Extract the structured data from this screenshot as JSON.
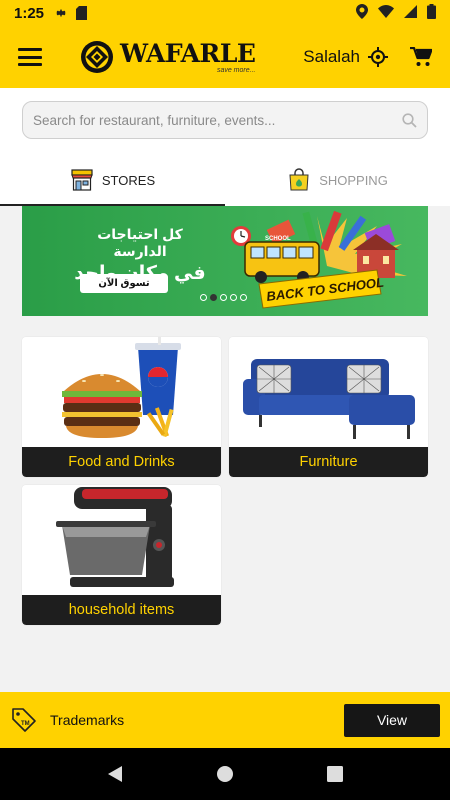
{
  "status_bar": {
    "time": "1:25"
  },
  "app_bar": {
    "logo_word": "WAFARLE",
    "logo_tagline": "save more...",
    "location": "Salalah"
  },
  "search": {
    "placeholder": "Search for restaurant, furniture, events..."
  },
  "tabs": [
    {
      "label": "STORES",
      "active": true
    },
    {
      "label": "SHOPPING",
      "active": false
    }
  ],
  "banner": {
    "line1": "كل احتياجات الدارسة",
    "line2": "في مكان واحد",
    "button_label": "تسوق الآن",
    "art_text": "BACK TO SCHOOL",
    "bus_text": "SCHOOL",
    "slides": 5,
    "active_slide": 2
  },
  "categories": [
    {
      "label": "Food and Drinks",
      "image": "burger-and-soda"
    },
    {
      "label": "Furniture",
      "image": "blue-sofa"
    },
    {
      "label": "household items",
      "image": "stand-mixer"
    }
  ],
  "trademarks": {
    "label": "Trademarks",
    "button_label": "View"
  },
  "colors": {
    "brand_yellow": "#ffd200",
    "banner_green": "#3cae56",
    "dark": "#1e1e1e"
  }
}
